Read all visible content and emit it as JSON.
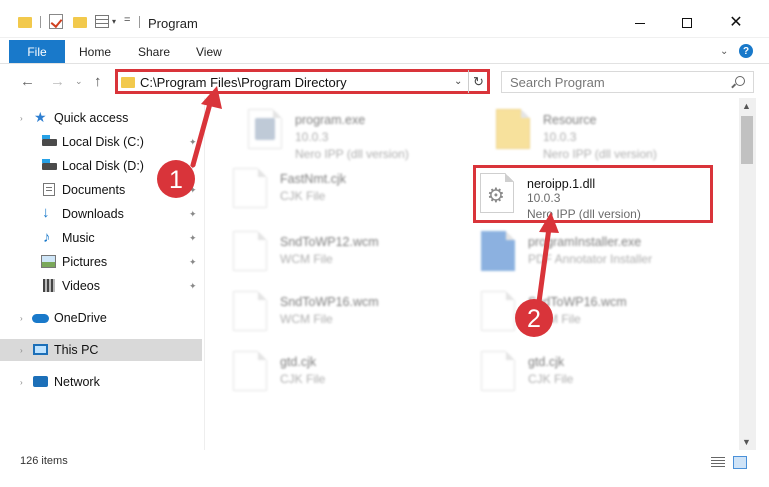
{
  "window": {
    "title": "Program",
    "quick_access_more": "=",
    "dropdown_glyph": "▾"
  },
  "ribbon": {
    "file_tab": "File",
    "home_tab": "Home",
    "share_tab": "Share",
    "view_tab": "View",
    "help_label": "?",
    "collapse_glyph": "⌄"
  },
  "navigation": {
    "back": "←",
    "forward": "→",
    "recent": "⌄",
    "up": "↑",
    "address_path": "C:\\Program Files\\Program Directory",
    "address_chevron": "⌄",
    "refresh": "↻",
    "search_placeholder": "Search Program"
  },
  "sidebar": {
    "items": [
      {
        "label": "Quick access",
        "icon": "star-icon"
      },
      {
        "label": "Local Disk (C:)",
        "icon": "disk-icon"
      },
      {
        "label": "Local Disk (D:)",
        "icon": "disk-icon"
      },
      {
        "label": "Documents",
        "icon": "documents-icon"
      },
      {
        "label": "Downloads",
        "icon": "downloads-icon"
      },
      {
        "label": "Music",
        "icon": "music-icon"
      },
      {
        "label": "Pictures",
        "icon": "pictures-icon"
      },
      {
        "label": "Videos",
        "icon": "videos-icon"
      },
      {
        "label": "OneDrive",
        "icon": "onedrive-icon"
      },
      {
        "label": "This PC",
        "icon": "computer-icon",
        "selected": true
      },
      {
        "label": "Network",
        "icon": "network-icon"
      }
    ],
    "pin_glyph": "📌"
  },
  "files": {
    "program_exe": {
      "name": "program.exe",
      "line1": "10.0.3",
      "line2": "Nero IPP (dll version)"
    },
    "resource": {
      "name": "Resource",
      "line1": "10.0.3",
      "line2": "Nero IPP (dll version)"
    },
    "fastnmt": {
      "name": "FastNmt.cjk",
      "line1": "CJK File"
    },
    "neroipp": {
      "name": "neroipp.1.dll",
      "line1": "10.0.3",
      "line2": "Nero IPP (dll version)"
    },
    "sndtowp12": {
      "name": "SndToWP12.wcm",
      "line1": "WCM File"
    },
    "installer": {
      "name": "programInstaller.exe",
      "line1": "PDF Annotator Installer"
    },
    "sndtowp16_left": {
      "name": "SndToWP16.wcm",
      "line1": "WCM File"
    },
    "sndtowp16_right": {
      "name": "SndToWP16.wcm",
      "line1": "WCM File"
    },
    "gtd_left": {
      "name": "gtd.cjk",
      "line1": "CJK File"
    },
    "gtd_right": {
      "name": "gtd.cjk",
      "line1": "CJK File"
    }
  },
  "scrollbar": {
    "up": "▲",
    "down": "▼"
  },
  "status": {
    "item_count": "126 items"
  },
  "annotations": {
    "step1": "1",
    "step2": "2",
    "color": "#d9343a"
  }
}
